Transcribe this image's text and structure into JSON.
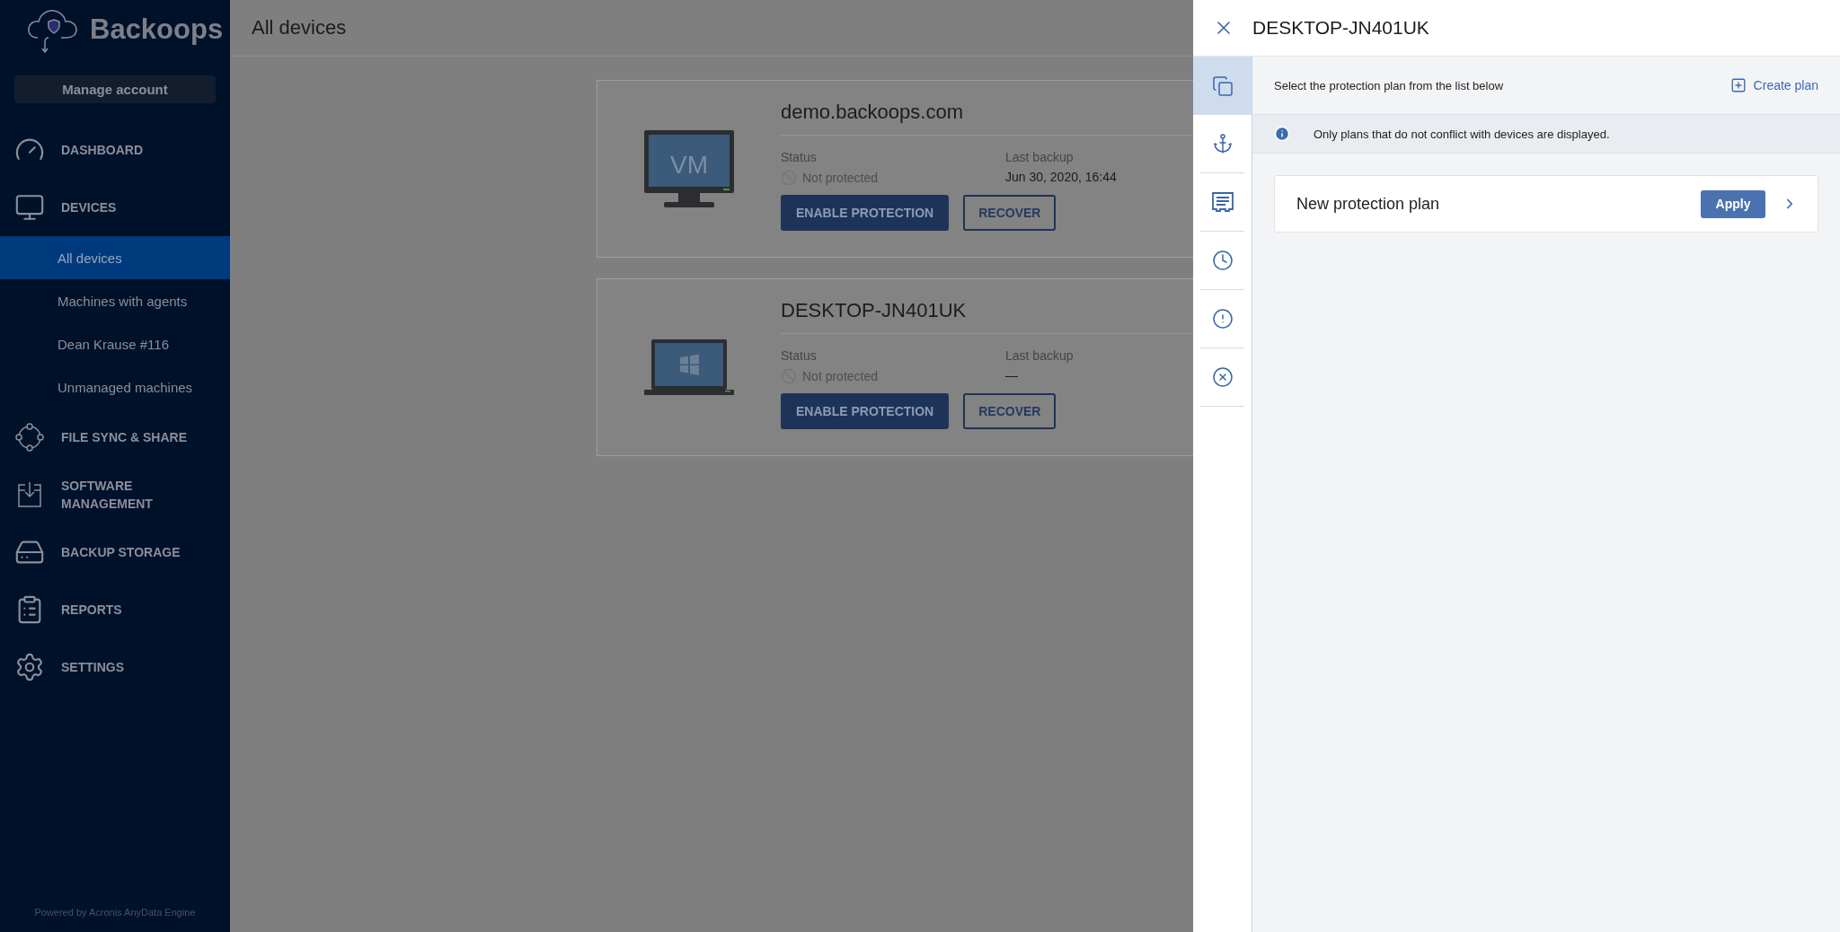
{
  "brand": {
    "name": "Backoops"
  },
  "account_button": "Manage account",
  "nav": [
    {
      "label": "DASHBOARD",
      "kind": "gauge"
    },
    {
      "label": "DEVICES",
      "kind": "monitor",
      "children": [
        {
          "label": "All devices",
          "selected": true
        },
        {
          "label": "Machines with agents",
          "selected": false
        },
        {
          "label": "Dean Krause #116",
          "selected": false
        },
        {
          "label": "Unmanaged machines",
          "selected": false
        }
      ]
    },
    {
      "label": "FILE SYNC & SHARE",
      "kind": "sync"
    },
    {
      "label": "SOFTWARE MANAGEMENT",
      "kind": "software"
    },
    {
      "label": "BACKUP STORAGE",
      "kind": "drive"
    },
    {
      "label": "REPORTS",
      "kind": "clipboard"
    },
    {
      "label": "SETTINGS",
      "kind": "gear"
    }
  ],
  "footer": "Powered by Acronis AnyData Engine",
  "page_title": "All devices",
  "devices": [
    {
      "name": "demo.backoops.com",
      "kind": "vm",
      "screen_label": "VM",
      "status_label": "Status",
      "status": "Not protected",
      "last_backup_label": "Last backup",
      "last_backup": "Jun 30, 2020, 16:44",
      "buttons": [
        "ENABLE PROTECTION",
        "RECOVER"
      ]
    },
    {
      "name": "DESKTOP-JN401UK",
      "kind": "laptop",
      "status_label": "Status",
      "status": "Not protected",
      "last_backup_label": "Last backup",
      "last_backup": "—",
      "buttons": [
        "ENABLE PROTECTION",
        "RECOVER"
      ]
    }
  ],
  "panel": {
    "title": "DESKTOP-JN401UK",
    "tabs": [
      {
        "kind": "plans",
        "selected": true
      },
      {
        "kind": "recovery",
        "selected": false
      },
      {
        "kind": "list",
        "selected": false
      },
      {
        "kind": "clock",
        "selected": false
      },
      {
        "kind": "alert",
        "selected": false
      },
      {
        "kind": "cancel",
        "selected": false
      }
    ],
    "instruction": "Select the protection plan from the list below",
    "create_link": "Create plan",
    "notice": "Only plans that do not conflict with devices are displayed.",
    "plans": [
      {
        "name": "New protection plan",
        "action": "Apply"
      }
    ]
  }
}
